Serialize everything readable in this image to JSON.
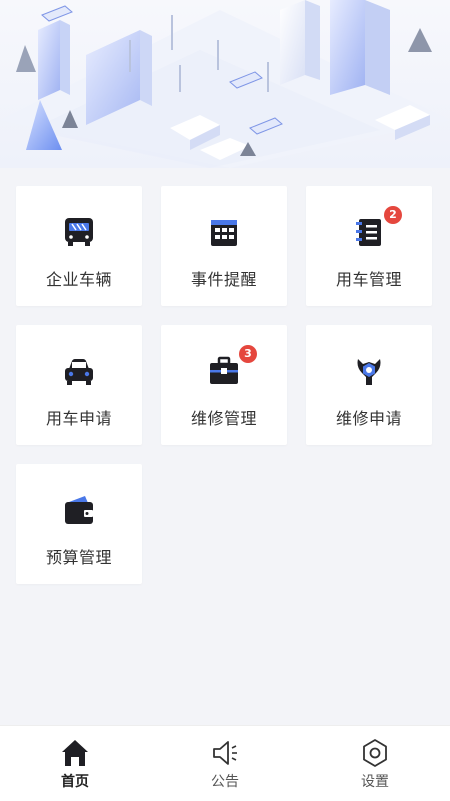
{
  "grid": {
    "items": [
      {
        "label": "企业车辆",
        "icon": "bus-icon"
      },
      {
        "label": "事件提醒",
        "icon": "calendar-icon"
      },
      {
        "label": "用车管理",
        "icon": "notebook-icon",
        "badge": "2"
      },
      {
        "label": "用车申请",
        "icon": "car-icon"
      },
      {
        "label": "维修管理",
        "icon": "toolbox-icon",
        "badge": "3"
      },
      {
        "label": "维修申请",
        "icon": "wrench-icon"
      },
      {
        "label": "预算管理",
        "icon": "wallet-icon"
      }
    ]
  },
  "tabbar": {
    "tabs": [
      {
        "label": "首页",
        "icon": "home-icon",
        "active": true
      },
      {
        "label": "公告",
        "icon": "megaphone-icon",
        "active": false
      },
      {
        "label": "设置",
        "icon": "settings-icon",
        "active": false
      }
    ]
  },
  "colors": {
    "badge": "#e5473e",
    "icon": "#1f1f24",
    "icon_accent": "#4a78e8",
    "background": "#f3f4f8"
  }
}
